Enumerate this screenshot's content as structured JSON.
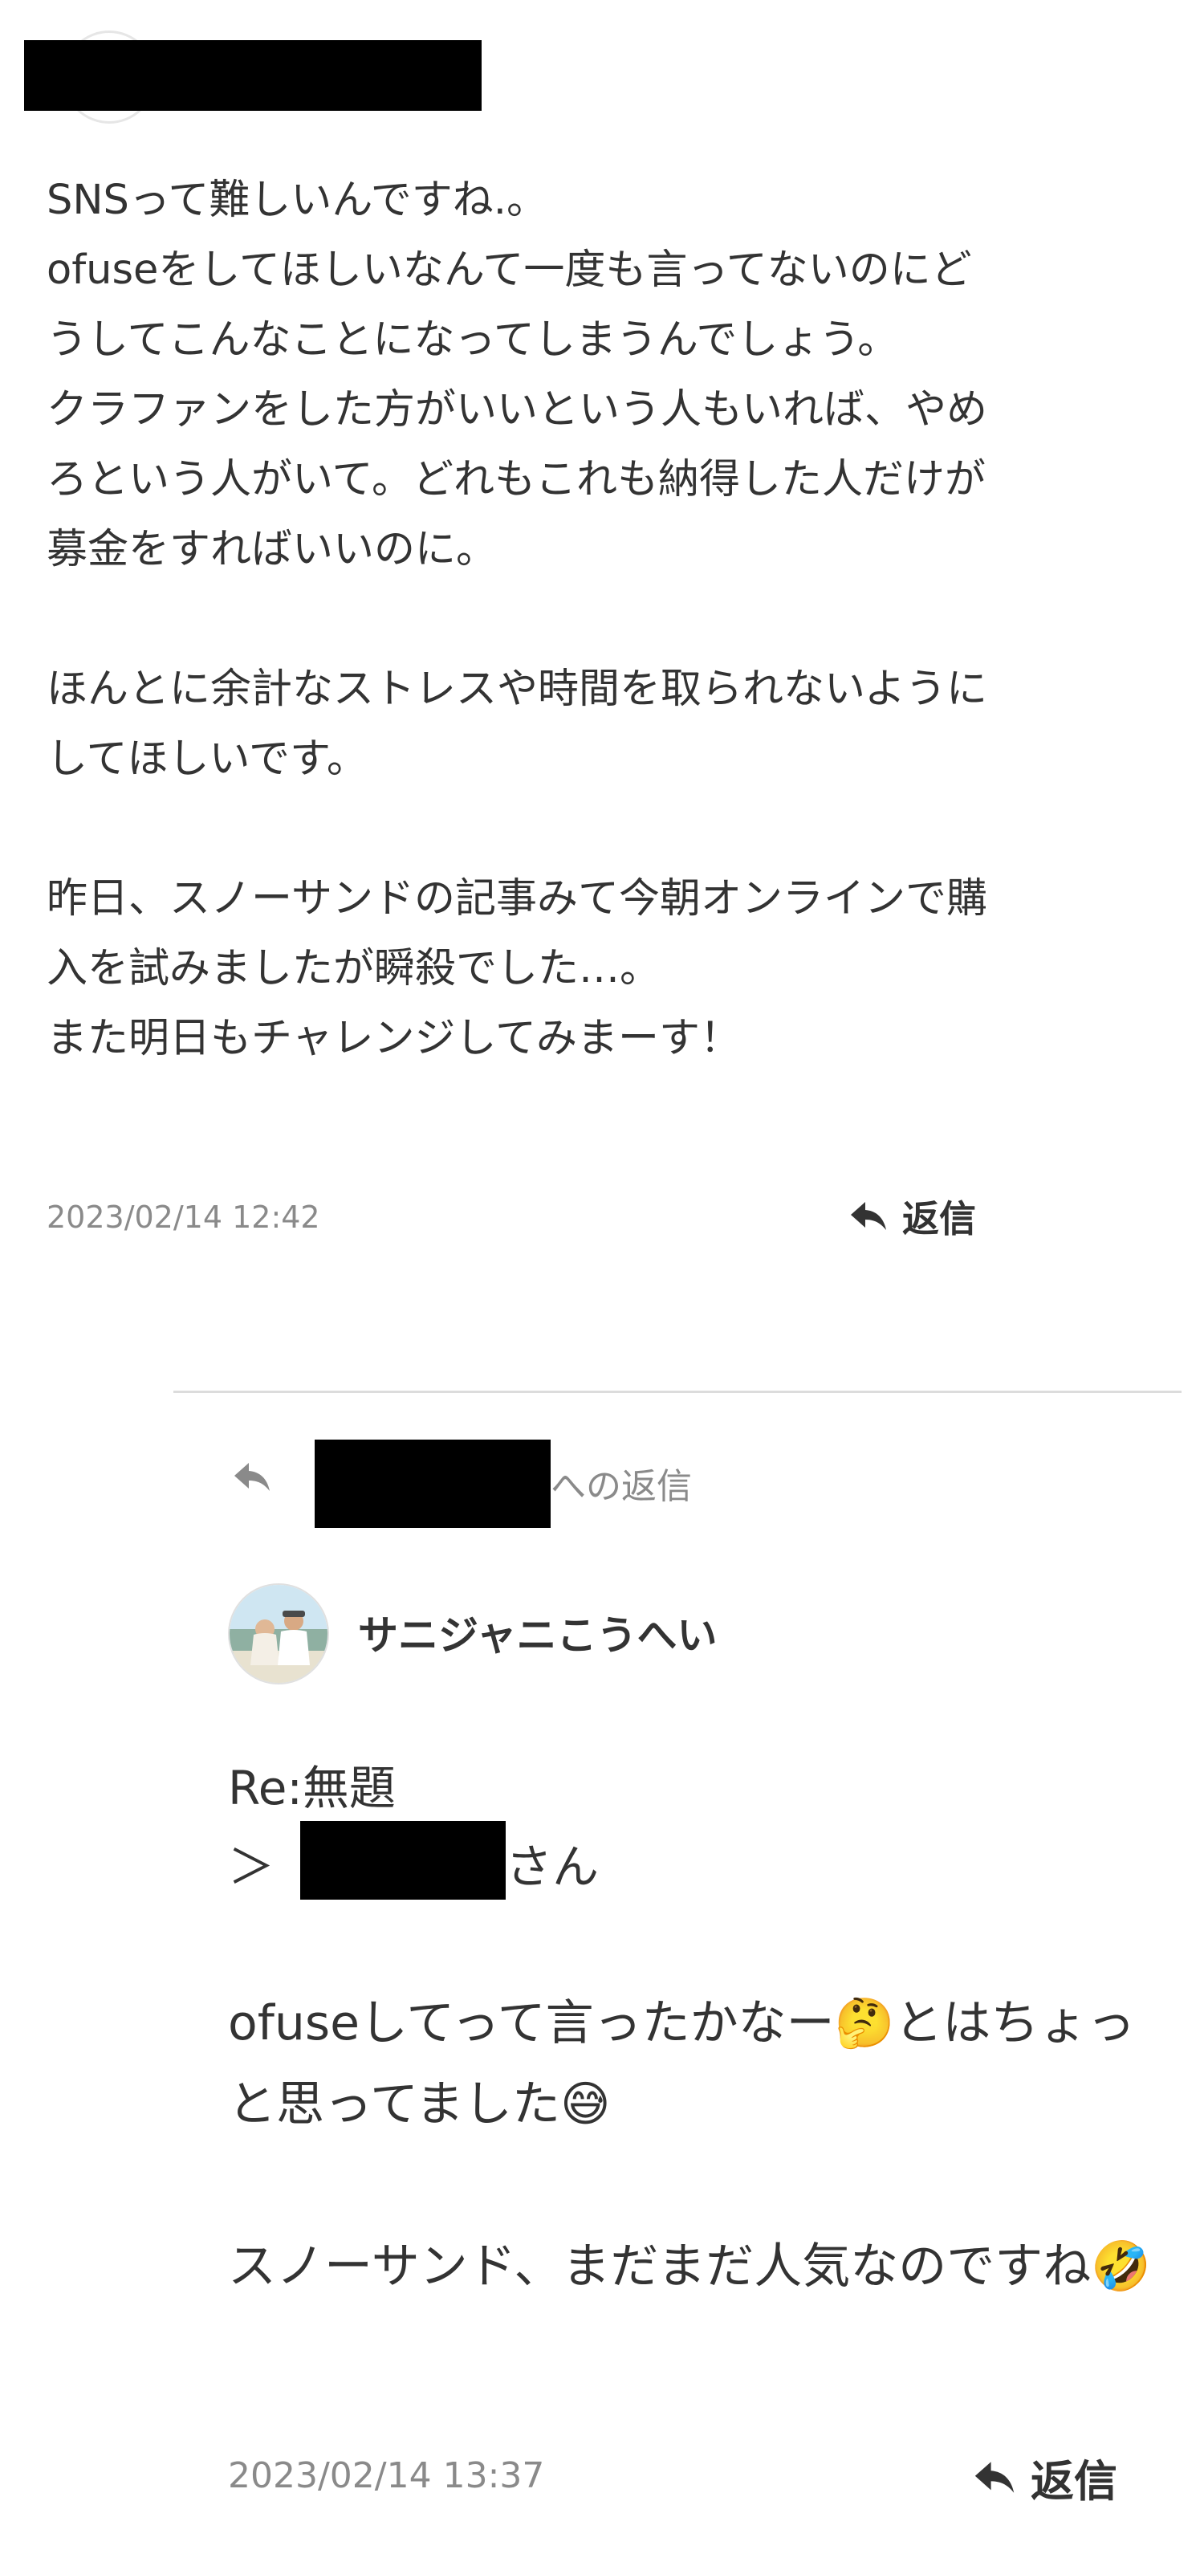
{
  "comment": {
    "author_redacted": true,
    "body": "SNSって難しいんですね.。\nofuseをしてほしいなんて一度も言ってないのにどうしてこんなことになってしまうんでしょう。\nクラファンをした方がいいという人もいれば、やめろという人がいて。どれもこれも納得した人だけが募金をすればいいのに。\n\nほんとに余計なストレスや時間を取られないようにしてほしいです。\n\n昨日、スノーサンドの記事みて今朝オンラインで購入を試みましたが瞬殺でした…。\nまた明日もチャレンジしてみまーす！",
    "timestamp": "2023/02/14 12:42",
    "reply_label": "返信",
    "reply_icon": "reply-arrow-icon"
  },
  "reply": {
    "reply_to_suffix": "への返信",
    "reply_to_icon": "reply-arrow-icon",
    "author_name": "サニジャニこうへい",
    "title": "Re:無題",
    "address_prefix": "＞",
    "address_suffix": "さん",
    "body": "ofuseしてって言ったかなー🤔とはちょっと思ってました😅\n\nスノーサンド、まだまだ人気なのですね🤣",
    "timestamp": "2023/02/14 13:37",
    "reply_label": "返信",
    "reply_icon": "reply-arrow-icon"
  },
  "colors": {
    "text": "#333333",
    "muted": "#8a8a8a",
    "divider": "#dcdcdc",
    "redaction": "#000000"
  }
}
